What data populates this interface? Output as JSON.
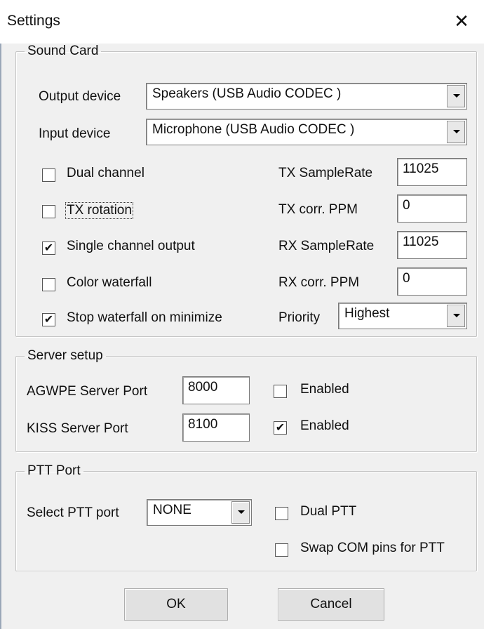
{
  "window": {
    "title": "Settings",
    "close_glyph": "✕"
  },
  "sound_card": {
    "legend": "Sound Card",
    "output_label": "Output device",
    "output_value": "Speakers (USB Audio CODEC )",
    "input_label": "Input device",
    "input_value": "Microphone (USB Audio CODEC )",
    "checkboxes": [
      {
        "label": "Dual channel",
        "checked": false
      },
      {
        "label": "TX rotation",
        "checked": false
      },
      {
        "label": "Single channel output",
        "checked": true
      },
      {
        "label": "Color waterfall",
        "checked": false
      },
      {
        "label": "Stop waterfall on minimize",
        "checked": true
      }
    ],
    "tx_samplerate_label": "TX SampleRate",
    "tx_samplerate_value": "11025",
    "tx_corr_label": "TX corr. PPM",
    "tx_corr_value": "0",
    "rx_samplerate_label": "RX SampleRate",
    "rx_samplerate_value": "11025",
    "rx_corr_label": "RX corr. PPM",
    "rx_corr_value": "0",
    "priority_label": "Priority",
    "priority_value": "Highest"
  },
  "server_setup": {
    "legend": "Server setup",
    "agwpe_label": "AGWPE Server Port",
    "agwpe_value": "8000",
    "agwpe_enabled_label": "Enabled",
    "agwpe_enabled": false,
    "kiss_label": "KISS Server Port",
    "kiss_value": "8100",
    "kiss_enabled_label": "Enabled",
    "kiss_enabled": true
  },
  "ptt_port": {
    "legend": "PTT Port",
    "select_label": "Select PTT port",
    "select_value": "NONE",
    "dual_ptt_label": "Dual PTT",
    "dual_ptt": false,
    "swap_label": "Swap COM pins for PTT",
    "swap": false
  },
  "buttons": {
    "ok": "OK",
    "cancel": "Cancel"
  },
  "check_glyph": "✔"
}
